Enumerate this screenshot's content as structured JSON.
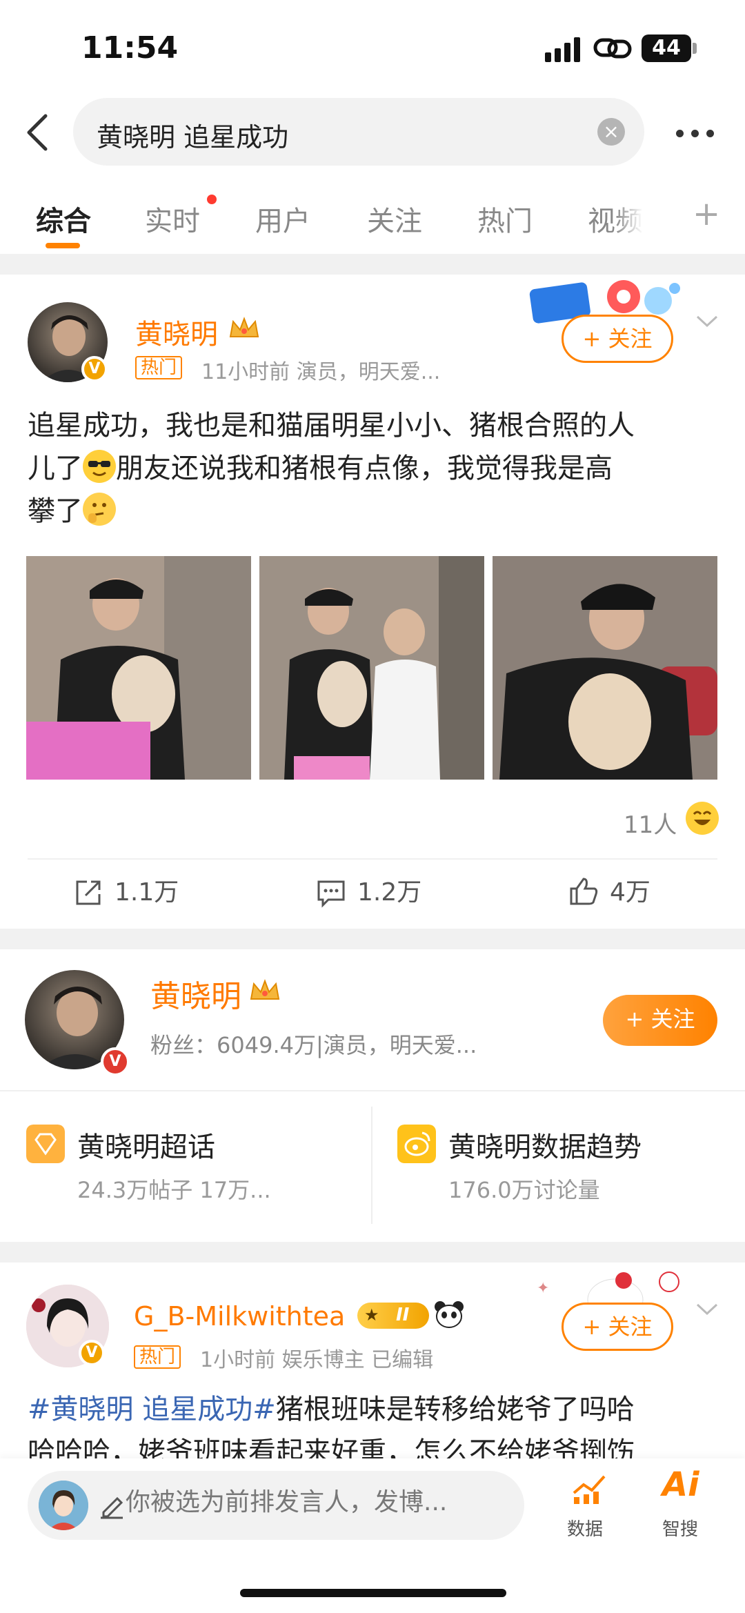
{
  "status_bar": {
    "time": "11:54",
    "battery": "44"
  },
  "search": {
    "query": "黄晓明 追星成功",
    "clear_icon": "×"
  },
  "tabs": [
    {
      "label": "综合",
      "active": true
    },
    {
      "label": "实时",
      "has_dot": true
    },
    {
      "label": "用户"
    },
    {
      "label": "关注"
    },
    {
      "label": "热门"
    },
    {
      "label": "视频"
    }
  ],
  "tab_add": "+",
  "post1": {
    "user_name": "黄晓明",
    "hot_tag": "热门",
    "meta": "11小时前  演员，明天爱...",
    "follow_label": "+ 关注",
    "text_line1": "追星成功，我也是和猫届明星小小、猪根合照的人",
    "text_line2a": "儿了",
    "text_line2b": "朋友还说我和猪根有点像，我觉得我是高",
    "text_line3": "攀了",
    "likes_people": "11人",
    "reposts": "1.1万",
    "comments": "1.2万",
    "likes": "4万"
  },
  "profile_card": {
    "name": "黄晓明",
    "fans": "粉丝：6049.4万|演员，明天爱...",
    "follow_label": "+ 关注",
    "links": [
      {
        "title": "黄晓明超话",
        "sub": "24.3万帖子  17万..."
      },
      {
        "title": "黄晓明数据趋势",
        "sub": "176.0万讨论量"
      }
    ]
  },
  "post2": {
    "user_name": "G_B-Milkwithtea",
    "level": "II",
    "hot_tag": "热门",
    "meta": "1小时前  娱乐博主  已编辑",
    "follow_label": "+ 关注",
    "hashtag": "#黄晓明 追星成功#",
    "text_line1_rest": "猪根班味是转移给姥爷了吗哈",
    "text_line2": "哈哈哈，姥爷班味看起来好重，怎么不给姥爷捯饬"
  },
  "bottom_bar": {
    "comment_placeholder": "你被选为前排发言人，发博...",
    "data_label": "数据",
    "ai_label": "智搜",
    "ai_glyph": "Ai"
  },
  "colors": {
    "accent": "#ff8200",
    "name": "#ff7a00",
    "hashtag": "#3a66b3"
  }
}
